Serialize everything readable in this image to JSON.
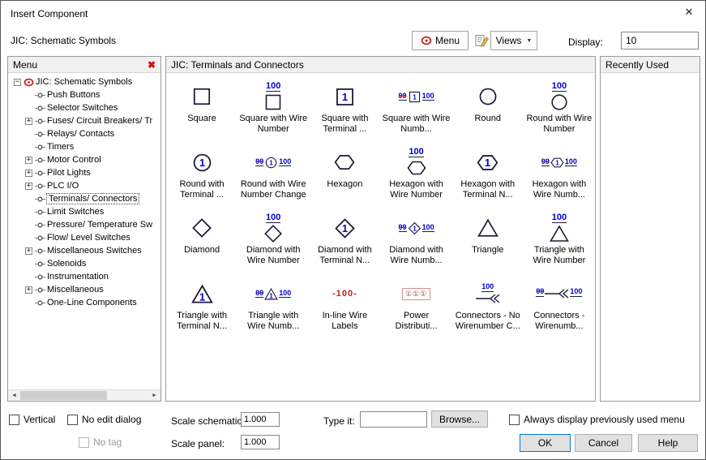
{
  "dialog": {
    "title": "Insert Component",
    "subtitle": "JIC: Schematic Symbols"
  },
  "toolbar": {
    "menu_button": "Menu",
    "views_button": "Views",
    "display_label": "Display:",
    "display_value": "10"
  },
  "menu_panel": {
    "header": "Menu",
    "tree": [
      {
        "label": "JIC: Schematic Symbols",
        "root": true,
        "expanded": true
      },
      {
        "label": "Push Buttons"
      },
      {
        "label": "Selector Switches"
      },
      {
        "label": "Fuses/ Circuit Breakers/ Tr",
        "plus": true
      },
      {
        "label": "Relays/ Contacts"
      },
      {
        "label": "Timers"
      },
      {
        "label": "Motor Control",
        "plus": true
      },
      {
        "label": "Pilot Lights",
        "plus": true
      },
      {
        "label": "PLC I/O",
        "plus": true
      },
      {
        "label": "Terminals/ Connectors",
        "selected": true
      },
      {
        "label": "Limit Switches"
      },
      {
        "label": "Pressure/ Temperature Sw"
      },
      {
        "label": "Flow/ Level Switches"
      },
      {
        "label": "Miscellaneous Switches",
        "plus": true
      },
      {
        "label": "Solenoids"
      },
      {
        "label": "Instrumentation"
      },
      {
        "label": "Miscellaneous",
        "plus": true
      },
      {
        "label": "One-Line Components"
      }
    ]
  },
  "symbols_panel": {
    "header": "JIC: Terminals and Connectors",
    "wire_number": "100",
    "old_wire_number": "99",
    "terminal_number": "1",
    "items": [
      {
        "label": "Square",
        "icon": "square"
      },
      {
        "label": "Square with Wire Number",
        "icon": "square-wire"
      },
      {
        "label": "Square with Terminal ...",
        "icon": "square-terminal"
      },
      {
        "label": "Square with Wire Numb...",
        "icon": "square-change"
      },
      {
        "label": "Round",
        "icon": "circle"
      },
      {
        "label": "Round with Wire Number",
        "icon": "circle-wire"
      },
      {
        "label": "Round with Terminal ...",
        "icon": "circle-terminal"
      },
      {
        "label": "Round with Wire Number Change",
        "icon": "circle-change"
      },
      {
        "label": "Hexagon",
        "icon": "hexagon"
      },
      {
        "label": "Hexagon with Wire Number",
        "icon": "hexagon-wire"
      },
      {
        "label": "Hexagon with Terminal N...",
        "icon": "hexagon-terminal"
      },
      {
        "label": "Hexagon with Wire Numb...",
        "icon": "hexagon-change"
      },
      {
        "label": "Diamond",
        "icon": "diamond"
      },
      {
        "label": "Diamond with Wire Number",
        "icon": "diamond-wire"
      },
      {
        "label": "Diamond with Terminal N...",
        "icon": "diamond-terminal"
      },
      {
        "label": "Diamond with Wire Numb...",
        "icon": "diamond-change"
      },
      {
        "label": "Triangle",
        "icon": "triangle"
      },
      {
        "label": "Triangle with Wire Number",
        "icon": "triangle-wire"
      },
      {
        "label": "Triangle with Terminal N...",
        "icon": "triangle-terminal"
      },
      {
        "label": "Triangle with Wire Numb...",
        "icon": "triangle-change"
      },
      {
        "label": "In-line Wire Labels",
        "icon": "inline-wire"
      },
      {
        "label": "Power Distributi...",
        "icon": "power-dist"
      },
      {
        "label": "Connectors - No Wirenumber C...",
        "icon": "connector-wire"
      },
      {
        "label": "Connectors - Wirenumb...",
        "icon": "connector-change"
      }
    ]
  },
  "recent_panel": {
    "header": "Recently Used"
  },
  "footer": {
    "vertical_label": "Vertical",
    "no_edit_label": "No edit dialog",
    "no_tag_label": "No tag",
    "scale_schematic_label": "Scale schematic:",
    "scale_schematic_value": "1.000",
    "scale_panel_label": "Scale panel:",
    "scale_panel_value": "1.000",
    "type_it_label": "Type it:",
    "type_it_value": "",
    "browse_label": "Browse...",
    "always_display_label": "Always display previously used menu",
    "ok_label": "OK",
    "cancel_label": "Cancel",
    "help_label": "Help"
  },
  "colors": {
    "wire_number_blue": "#0000cc",
    "symbol_stroke": "#1c1c3a",
    "inline_wire_red": "#bb2222",
    "ok_default_border": "#0078d7"
  }
}
